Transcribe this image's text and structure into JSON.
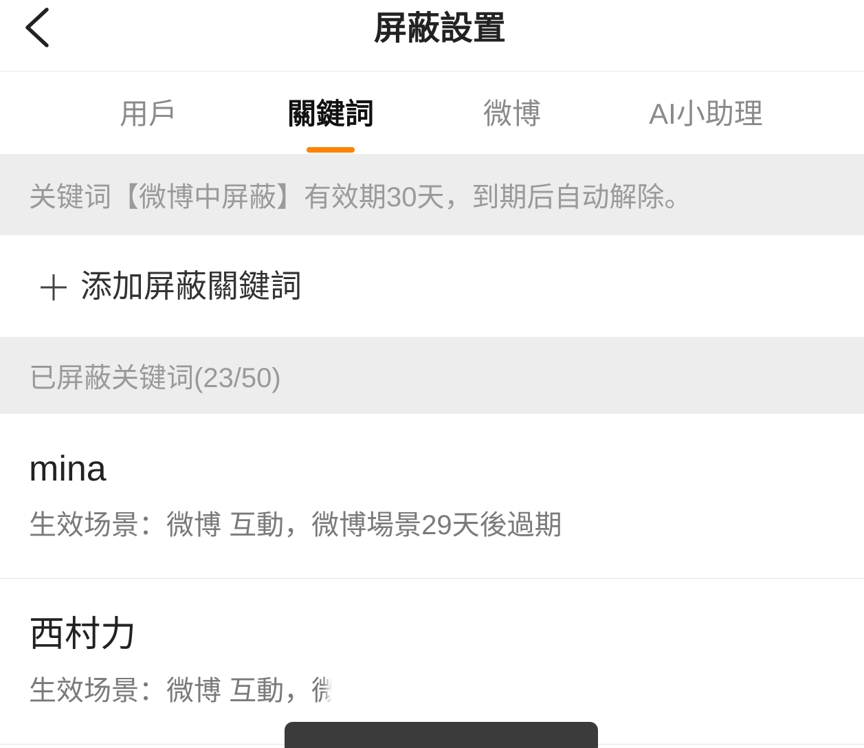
{
  "header": {
    "back_icon": "chevron-left-icon",
    "title": "屏蔽設置"
  },
  "tabs": [
    {
      "label": "用戶",
      "active": false
    },
    {
      "label": "關鍵詞",
      "active": true
    },
    {
      "label": "微博",
      "active": false
    },
    {
      "label": "AI小助理",
      "active": false
    }
  ],
  "notice": {
    "text": "关键词【微博中屏蔽】有效期30天，到期后自动解除。"
  },
  "add_keyword": {
    "icon": "plus-icon",
    "label": "添加屏蔽關鍵詞"
  },
  "blocked_section": {
    "title": "已屏蔽关键词(23/50)"
  },
  "keywords": [
    {
      "keyword": "mina",
      "detail": "生效场景：微博 互動，微博場景29天後過期"
    },
    {
      "keyword": "西村力",
      "detail": "生效场景：微博 互動，微"
    }
  ],
  "colors": {
    "accent": "#ff8200",
    "text_primary": "#222222",
    "tab_inactive": "#8a8a8a",
    "section_background": "#ededed",
    "toast_background": "#3b3b3b"
  }
}
